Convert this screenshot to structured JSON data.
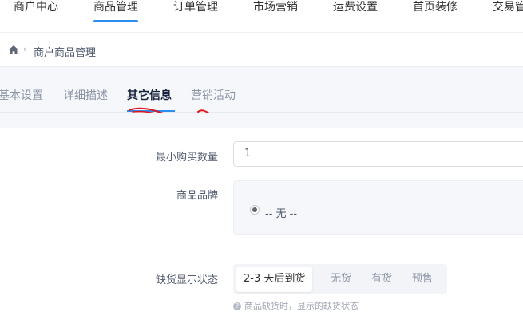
{
  "topnav": {
    "items": [
      "商户中心",
      "商品管理",
      "订单管理",
      "市场营销",
      "运费设置",
      "首页装修",
      "交易管"
    ],
    "active_index": 1
  },
  "breadcrumb": {
    "icon": "home-icon",
    "text": "商户商品管理"
  },
  "tabs": {
    "items": [
      "基本设置",
      "详细描述",
      "其它信息",
      "营销活动"
    ],
    "active_index": 2
  },
  "form": {
    "min_qty": {
      "label": "最小购买数量",
      "value": "1"
    },
    "brand": {
      "label": "商品品牌",
      "option": "-- 无 --",
      "selected": true
    },
    "stock_status": {
      "label": "缺货显示状态",
      "options": [
        "2-3 天后到货",
        "无货",
        "有货",
        "预售"
      ],
      "selected_index": 0,
      "hint": "商品缺货时，显示的缺货状态"
    }
  },
  "colors": {
    "accent": "#2d8cf0",
    "annotation": "#e0181b"
  }
}
